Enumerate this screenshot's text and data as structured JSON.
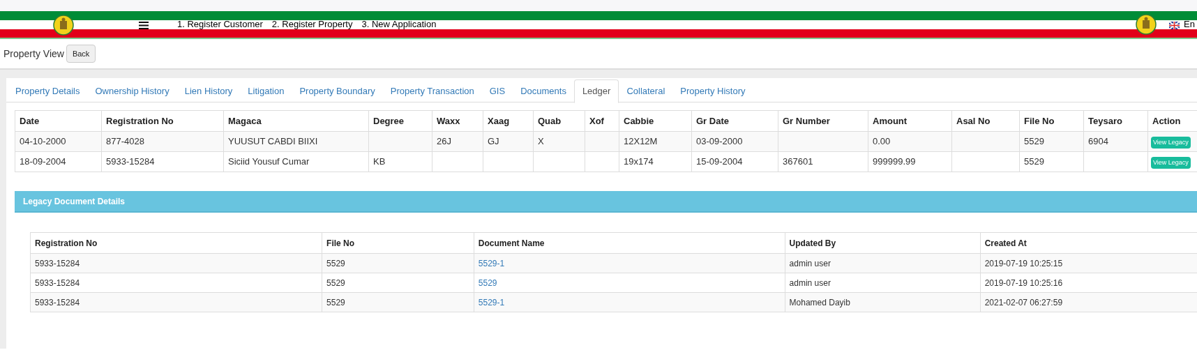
{
  "header": {
    "nav": [
      "1. Register Customer",
      "2. Register Property",
      "3. New Application"
    ],
    "language": "En"
  },
  "page": {
    "title": "Property View",
    "back_button": "Back"
  },
  "tabs": [
    {
      "label": "Property Details",
      "selected": false
    },
    {
      "label": "Ownership History",
      "selected": false
    },
    {
      "label": "Lien History",
      "selected": false
    },
    {
      "label": "Litigation",
      "selected": false
    },
    {
      "label": "Property Boundary",
      "selected": false
    },
    {
      "label": "Property Transaction",
      "selected": false
    },
    {
      "label": "GIS",
      "selected": false
    },
    {
      "label": "Documents",
      "selected": false
    },
    {
      "label": "Ledger",
      "selected": true
    },
    {
      "label": "Collateral",
      "selected": false
    },
    {
      "label": "Property History",
      "selected": false
    }
  ],
  "ledger": {
    "columns": [
      "Date",
      "Registration No",
      "Magaca",
      "Degree",
      "Waxx",
      "Xaag",
      "Quab",
      "Xof",
      "Cabbie",
      "Gr Date",
      "Gr Number",
      "Amount",
      "Asal No",
      "File No",
      "Teysaro",
      "Action"
    ],
    "rows": [
      {
        "cells": [
          "04-10-2000",
          "877-4028",
          "YUUSUT CABDI BIIXI",
          "",
          "26J",
          "GJ",
          "X",
          "",
          "12X12M",
          "03-09-2000",
          "",
          "0.00",
          "",
          "5529",
          "6904"
        ],
        "action": "View Legacy"
      },
      {
        "cells": [
          "18-09-2004",
          "5933-15284",
          "Siciid Yousuf Cumar",
          "KB",
          "",
          "",
          "",
          "",
          "19x174",
          "15-09-2004",
          "367601",
          "999999.99",
          "",
          "5529",
          ""
        ],
        "action": "View Legacy"
      }
    ]
  },
  "legacy": {
    "title": "Legacy Document Details",
    "columns": [
      "Registration No",
      "File No",
      "Document Name",
      "Updated By",
      "Created At"
    ],
    "rows": [
      [
        "5933-15284",
        "5529",
        "5529-1",
        "admin user",
        "2019-07-19 10:25:15"
      ],
      [
        "5933-15284",
        "5529",
        "5529",
        "admin user",
        "2019-07-19 10:25:16"
      ],
      [
        "5933-15284",
        "5529",
        "5529-1",
        "Mohamed Dayib",
        "2021-02-07 06:27:59"
      ]
    ]
  }
}
